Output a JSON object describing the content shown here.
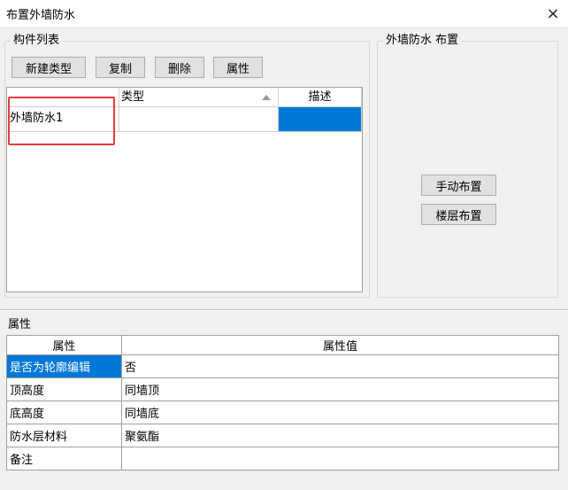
{
  "window": {
    "title": "布置外墙防水",
    "close_icon": "×"
  },
  "component_list": {
    "group_label": "构件列表",
    "buttons": {
      "new_type": "新建类型",
      "copy": "复制",
      "delete": "删除",
      "properties": "属性"
    },
    "columns": {
      "name": "",
      "type": "类型",
      "description": "描述"
    },
    "rows": [
      {
        "name": "外墙防水1",
        "type": "",
        "description": ""
      }
    ],
    "selection_color": "#0078d7",
    "highlight_box_color": "#e53c3c"
  },
  "layout_panel": {
    "group_label": "外墙防水 布置",
    "buttons": {
      "manual": "手动布置",
      "floor": "楼层布置"
    }
  },
  "properties": {
    "section_label": "属性",
    "columns": {
      "name": "属性",
      "value": "属性值"
    },
    "rows": [
      {
        "name": "是否为轮廓编辑",
        "value": "否"
      },
      {
        "name": "顶高度",
        "value": "同墙顶"
      },
      {
        "name": "底高度",
        "value": "同墙底"
      },
      {
        "name": "防水层材料",
        "value": "聚氨酯"
      },
      {
        "name": "备注",
        "value": ""
      }
    ]
  }
}
